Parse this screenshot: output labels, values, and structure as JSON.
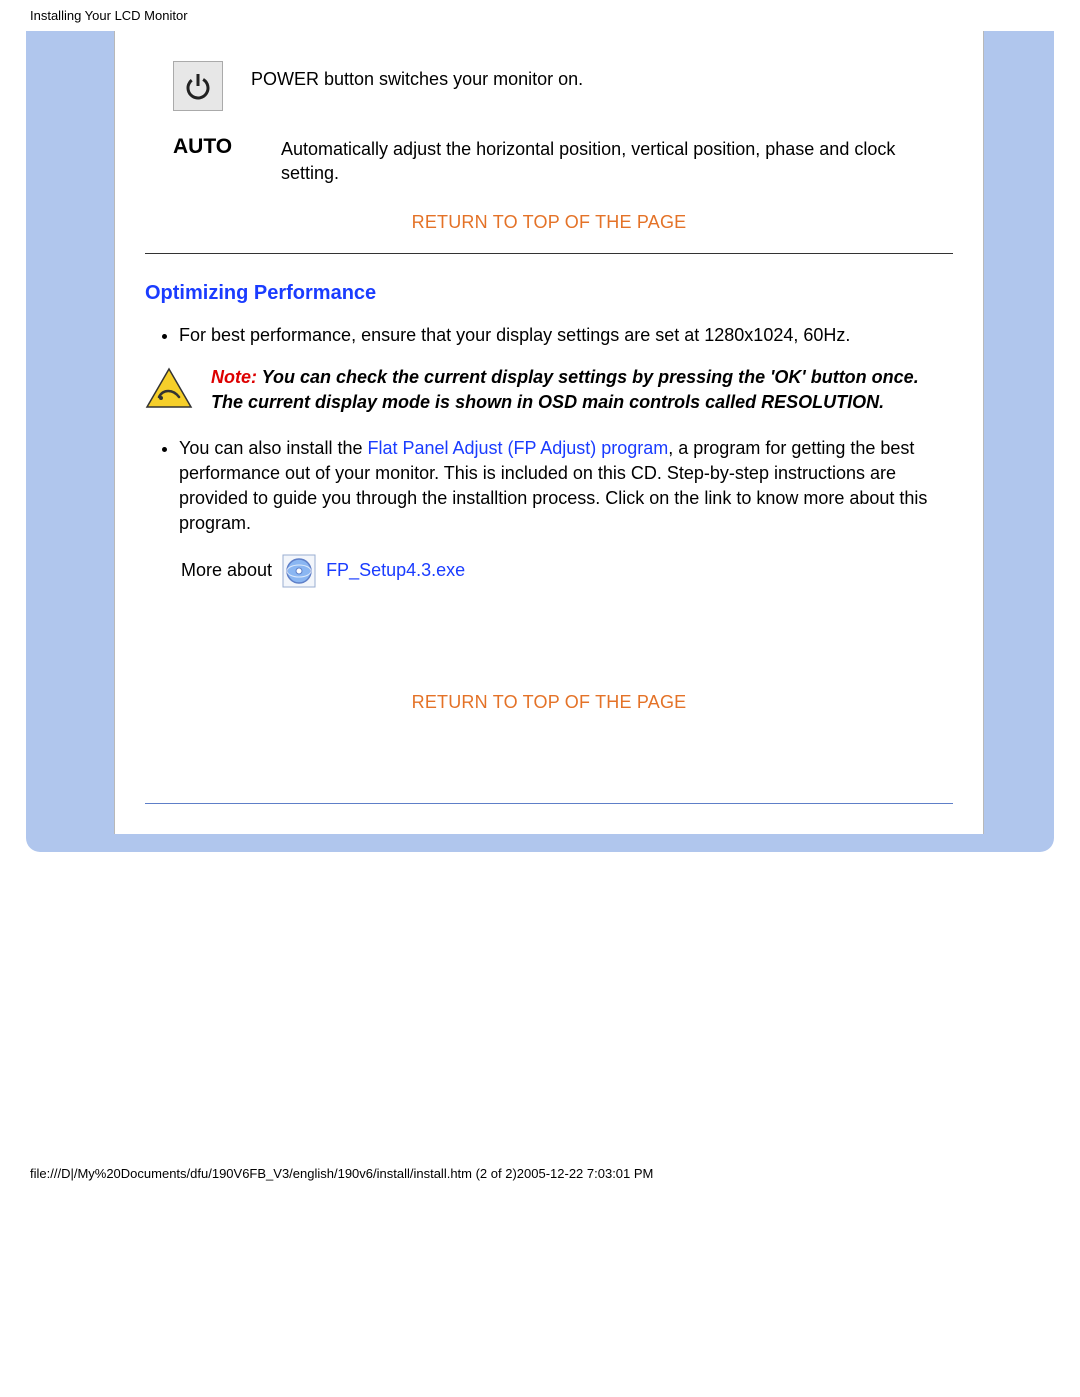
{
  "header": {
    "title": "Installing Your LCD Monitor"
  },
  "controls": {
    "power_desc": "POWER button switches your monitor on.",
    "auto_label": "AUTO",
    "auto_desc": "Automatically adjust the horizontal position, vertical position, phase and clock setting."
  },
  "links": {
    "return_top": "RETURN TO TOP OF THE PAGE",
    "fp_adjust": "Flat Panel Adjust (FP Adjust) program",
    "fp_setup": "FP_Setup4.3.exe"
  },
  "section": {
    "optimizing_heading": "Optimizing Performance",
    "bullet1": "For best performance, ensure that your display settings are set at 1280x1024, 60Hz.",
    "note_prefix": "Note: ",
    "note_body": "You can check the current display settings by pressing the 'OK' button once. The current display mode is shown in OSD main controls called RESOLUTION.",
    "bullet2_pre": "You can also install the ",
    "bullet2_post": ", a program for getting the best performance out of your monitor. This is included on this CD. Step-by-step instructions are provided to guide you through the installtion process. Click on the link to know more about this program.",
    "more_about": "More about"
  },
  "footer": {
    "path": "file:///D|/My%20Documents/dfu/190V6FB_V3/english/190v6/install/install.htm (2 of 2)2005-12-22 7:03:01 PM"
  }
}
